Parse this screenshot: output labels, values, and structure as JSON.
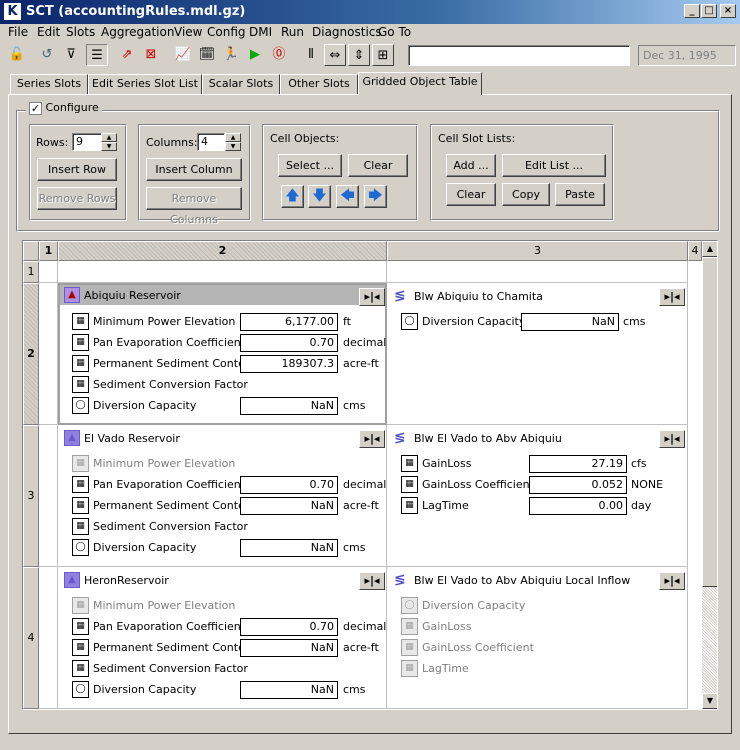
{
  "window": {
    "title": "SCT  (accountingRules.mdl.gz)",
    "icon": "sct-app-icon",
    "buttons": [
      "_",
      "□",
      "×"
    ]
  },
  "menu": [
    "File",
    "Edit",
    "Slots",
    "Aggregation",
    "View",
    "Config",
    "DMI",
    "Run",
    "Diagnostics",
    "Go To"
  ],
  "toolbar": {
    "search_value": "",
    "date": "Dec 31, 1995"
  },
  "tabs": [
    "Series Slots",
    "Edit Series Slot List",
    "Scalar Slots",
    "Other Slots",
    "Gridded Object Table"
  ],
  "active_tab": "Gridded Object Table",
  "configure": {
    "label": "Configure",
    "checked": true,
    "rows_label": "Rows:",
    "rows_value": "9",
    "insert_row": "Insert Row",
    "remove_rows": "Remove Rows",
    "columns_label": "Columns:",
    "columns_value": "4",
    "insert_column": "Insert Column",
    "remove_columns": "Remove Columns",
    "cell_objects_label": "Cell Objects:",
    "select_button": "Select ...",
    "clear_button": "Clear",
    "cell_slot_lists_label": "Cell Slot Lists:",
    "add_button": "Add ...",
    "edit_list_button": "Edit List ...",
    "clear_list_button": "Clear",
    "copy_button": "Copy",
    "paste_button": "Paste"
  },
  "grid": {
    "col_headers": [
      "1",
      "2",
      "3",
      "4"
    ],
    "row_headers": [
      "1",
      "2",
      "3",
      "4"
    ],
    "cells": {
      "r2c2": {
        "name": "Abiquiu Reservoir",
        "slots": [
          {
            "label": "Minimum Power Elevation",
            "value": "6,177.00",
            "unit": "ft",
            "icon": "table-slot-icon",
            "enabled": true
          },
          {
            "label": "Pan Evaporation Coefficient",
            "value": "0.70",
            "unit": "decimal",
            "icon": "table-slot-icon",
            "enabled": true
          },
          {
            "label": "Permanent Sediment Content",
            "value": "189307.3",
            "unit": "acre-ft",
            "icon": "table-slot-icon",
            "enabled": true
          },
          {
            "label": "Sediment Conversion Factor",
            "value": "",
            "unit": "",
            "icon": "table-slot-icon",
            "enabled": true
          },
          {
            "label": "Diversion Capacity",
            "value": "NaN",
            "unit": "cms",
            "icon": "scalar-slot-icon",
            "enabled": true
          }
        ]
      },
      "r2c3": {
        "name": "Blw Abiquiu to Chamita",
        "slots": [
          {
            "label": "Diversion Capacity",
            "value": "NaN",
            "unit": "cms",
            "icon": "scalar-slot-icon",
            "enabled": true
          }
        ]
      },
      "r3c2": {
        "name": "El Vado Reservoir",
        "slots": [
          {
            "label": "Minimum Power Elevation",
            "value": "",
            "unit": "",
            "icon": "table-slot-icon",
            "enabled": false
          },
          {
            "label": "Pan Evaporation Coefficient",
            "value": "0.70",
            "unit": "decimal",
            "icon": "table-slot-icon",
            "enabled": true
          },
          {
            "label": "Permanent Sediment Content",
            "value": "NaN",
            "unit": "acre-ft",
            "icon": "table-slot-icon",
            "enabled": true
          },
          {
            "label": "Sediment Conversion Factor",
            "value": "",
            "unit": "",
            "icon": "table-slot-icon",
            "enabled": true
          },
          {
            "label": "Diversion Capacity",
            "value": "NaN",
            "unit": "cms",
            "icon": "scalar-slot-icon",
            "enabled": true
          }
        ]
      },
      "r3c3": {
        "name": "Blw El Vado to Abv Abiquiu",
        "slots": [
          {
            "label": "GainLoss",
            "value": "27.19",
            "unit": "cfs",
            "icon": "table-slot-icon",
            "enabled": true
          },
          {
            "label": "GainLoss Coefficient",
            "value": "0.052",
            "unit": "NONE",
            "icon": "table-slot-icon",
            "enabled": true
          },
          {
            "label": "LagTime",
            "value": "0.00",
            "unit": "day",
            "icon": "table-slot-icon",
            "enabled": true
          }
        ]
      },
      "r4c2": {
        "name": "HeronReservoir",
        "slots": [
          {
            "label": "Minimum Power Elevation",
            "value": "",
            "unit": "",
            "icon": "table-slot-icon",
            "enabled": false
          },
          {
            "label": "Pan Evaporation Coefficient",
            "value": "0.70",
            "unit": "decimal",
            "icon": "table-slot-icon",
            "enabled": true
          },
          {
            "label": "Permanent Sediment Content",
            "value": "NaN",
            "unit": "acre-ft",
            "icon": "table-slot-icon",
            "enabled": true
          },
          {
            "label": "Sediment Conversion Factor",
            "value": "",
            "unit": "",
            "icon": "table-slot-icon",
            "enabled": true
          },
          {
            "label": "Diversion Capacity",
            "value": "NaN",
            "unit": "cms",
            "icon": "scalar-slot-icon",
            "enabled": true
          }
        ]
      },
      "r4c3": {
        "name": "Blw El Vado to Abv Abiquiu Local Inflow",
        "slots": [
          {
            "label": "Diversion Capacity",
            "value": "",
            "unit": "",
            "icon": "scalar-slot-icon",
            "enabled": false
          },
          {
            "label": "GainLoss",
            "value": "",
            "unit": "",
            "icon": "table-slot-icon",
            "enabled": false
          },
          {
            "label": "GainLoss Coefficient",
            "value": "",
            "unit": "",
            "icon": "table-slot-icon",
            "enabled": false
          },
          {
            "label": "LagTime",
            "value": "",
            "unit": "",
            "icon": "table-slot-icon",
            "enabled": false
          }
        ]
      }
    }
  },
  "colors": {
    "title_bar": "#0a246a",
    "selected_cell": "#b4b4b4",
    "reservoir_icon": "#6a5acd",
    "reach_icon": "#5050c8"
  }
}
